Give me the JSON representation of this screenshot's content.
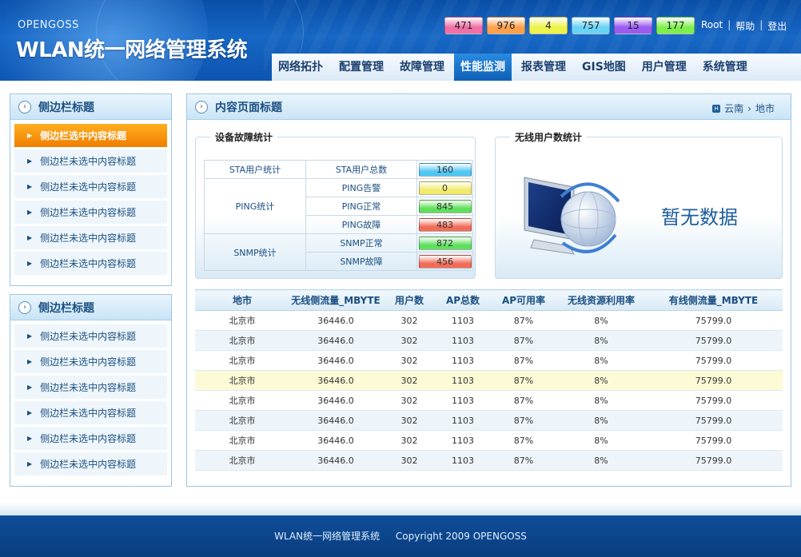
{
  "header": {
    "brand_small": "OPENGOSS",
    "brand_title": "WLAN统一网络管理系统",
    "badges": [
      {
        "value": "471",
        "color": "#f06fa6"
      },
      {
        "value": "976",
        "color": "#ffa04a"
      },
      {
        "value": "4",
        "color": "#eef34a"
      },
      {
        "value": "757",
        "color": "#69d3f7"
      },
      {
        "value": "15",
        "color": "#9a5cf0"
      },
      {
        "value": "177",
        "color": "#7df04c"
      }
    ],
    "links": {
      "user": "Root",
      "help": "帮助",
      "logout": "登出",
      "sep": "|"
    }
  },
  "nav": {
    "tabs": [
      {
        "label": "网络拓扑"
      },
      {
        "label": "配置管理"
      },
      {
        "label": "故障管理"
      },
      {
        "label": "性能监测",
        "active": true
      },
      {
        "label": "报表管理"
      },
      {
        "label": "GIS地图"
      },
      {
        "label": "用户管理"
      },
      {
        "label": "系统管理"
      }
    ]
  },
  "sidebar": {
    "box1": {
      "title": "侧边栏标题",
      "items": [
        {
          "label": "侧边栏选中内容标题",
          "selected": true
        },
        {
          "label": "侧边栏未选中内容标题"
        },
        {
          "label": "侧边栏未选中内容标题"
        },
        {
          "label": "侧边栏未选中内容标题"
        },
        {
          "label": "侧边栏未选中内容标题"
        },
        {
          "label": "侧边栏未选中内容标题"
        }
      ]
    },
    "box2": {
      "title": "侧边栏标题",
      "items": [
        {
          "label": "侧边栏未选中内容标题"
        },
        {
          "label": "侧边栏未选中内容标题"
        },
        {
          "label": "侧边栏未选中内容标题"
        },
        {
          "label": "侧边栏未选中内容标题"
        },
        {
          "label": "侧边栏未选中内容标题"
        },
        {
          "label": "侧边栏未选中内容标题"
        }
      ]
    }
  },
  "main": {
    "title": "内容页面标题",
    "breadcrumb": {
      "home_icon": "H",
      "province": "云南",
      "arrow": "›",
      "current": "地市"
    },
    "fault_stats": {
      "legend": "设备故障统计",
      "groups": {
        "sta": "STA用户统计",
        "ping": "PING统计",
        "snmp": "SNMP统计"
      },
      "rows": [
        {
          "label": "STA用户总数",
          "value": "160",
          "color": "#4ec7f5"
        },
        {
          "label": "PING告警",
          "value": "0",
          "color": "#f0ea6a"
        },
        {
          "label": "PING正常",
          "value": "845",
          "color": "#5fe05c"
        },
        {
          "label": "PING故障",
          "value": "483",
          "color": "#f26b56"
        },
        {
          "label": "SNMP正常",
          "value": "872",
          "color": "#5fe05c"
        },
        {
          "label": "SNMP故障",
          "value": "456",
          "color": "#f26b56"
        }
      ]
    },
    "wireless": {
      "legend": "无线用户数统计",
      "no_data": "暂无数据",
      "icon": "monitor-globe-icon"
    },
    "table": {
      "headers": [
        "地市",
        "无线侧流量_MBYTE",
        "用户数",
        "AP总数",
        "AP可用率",
        "无线资源利用率",
        "有线侧流量_MBYTE"
      ],
      "rows": [
        [
          "北京市",
          "36446.0",
          "302",
          "1103",
          "87%",
          "8%",
          "75799.0"
        ],
        [
          "北京市",
          "36446.0",
          "302",
          "1103",
          "87%",
          "8%",
          "75799.0"
        ],
        [
          "北京市",
          "36446.0",
          "302",
          "1103",
          "87%",
          "8%",
          "75799.0"
        ],
        [
          "北京市",
          "36446.0",
          "302",
          "1103",
          "87%",
          "8%",
          "75799.0"
        ],
        [
          "北京市",
          "36446.0",
          "302",
          "1103",
          "87%",
          "8%",
          "75799.0"
        ],
        [
          "北京市",
          "36446.0",
          "302",
          "1103",
          "87%",
          "8%",
          "75799.0"
        ],
        [
          "北京市",
          "36446.0",
          "302",
          "1103",
          "87%",
          "8%",
          "75799.0"
        ],
        [
          "北京市",
          "36446.0",
          "302",
          "1103",
          "87%",
          "8%",
          "75799.0"
        ]
      ],
      "highlight_row": 3
    }
  },
  "footer": {
    "system": "WLAN统一网络管理系统",
    "copyright": "Copyright 2009 OPENGOSS"
  }
}
